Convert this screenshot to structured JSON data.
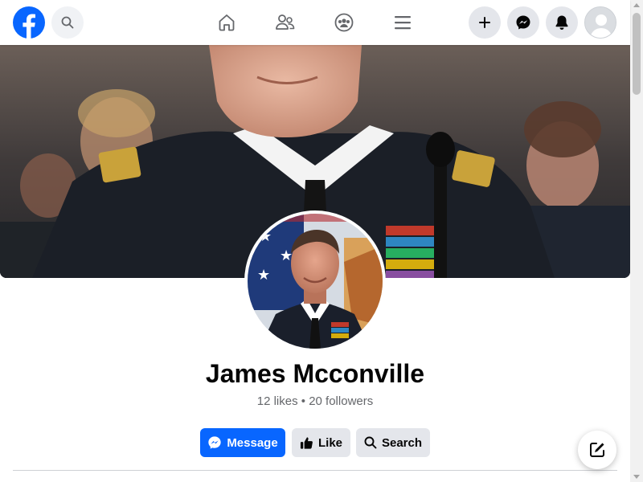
{
  "app": {
    "brand_color": "#0866ff"
  },
  "topbar": {
    "logo_icon": "facebook-logo-icon",
    "search_icon": "search-icon",
    "nav": [
      {
        "name": "home",
        "icon": "home-icon"
      },
      {
        "name": "friends",
        "icon": "friends-icon"
      },
      {
        "name": "groups",
        "icon": "groups-icon"
      },
      {
        "name": "menu",
        "icon": "menu-icon"
      }
    ],
    "right_buttons": [
      {
        "name": "create",
        "icon": "plus-icon"
      },
      {
        "name": "messenger",
        "icon": "messenger-icon"
      },
      {
        "name": "notifications",
        "icon": "bell-icon"
      }
    ],
    "avatar_icon": "default-avatar-icon"
  },
  "profile": {
    "name": "James Mcconville",
    "stats": "12 likes • 20 followers"
  },
  "actions": {
    "message_label": "Message",
    "like_label": "Like",
    "search_label": "Search"
  },
  "floating": {
    "compose_icon": "compose-icon"
  }
}
